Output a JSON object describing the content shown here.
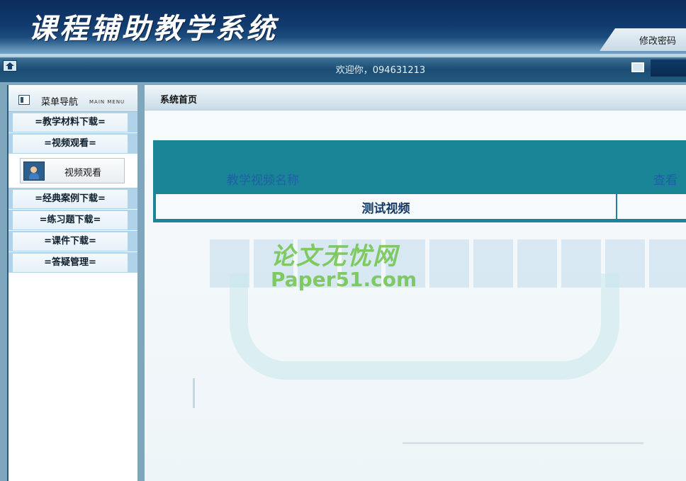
{
  "header": {
    "app_title": "课程辅助教学系统",
    "change_password": "修改密码"
  },
  "welcome_bar": {
    "text": "欢迎你，094631213"
  },
  "sidebar": {
    "title": "菜单导航",
    "subtitle": "MAIN MENU",
    "items": [
      {
        "label": "=教学材料下载="
      },
      {
        "label": "=视频观看="
      },
      {
        "label": "=经典案例下载="
      },
      {
        "label": "=练习题下载="
      },
      {
        "label": "=课件下载="
      },
      {
        "label": "=答疑管理="
      }
    ],
    "sub_item": {
      "label": "视频观看"
    }
  },
  "main": {
    "page_title": "系统首页",
    "table": {
      "columns": [
        "教学视频名称",
        "查看"
      ],
      "rows": [
        {
          "name": "测试视频",
          "view": ""
        }
      ]
    }
  },
  "watermark": {
    "line1": "论文无忧网",
    "line2": "Paper51.com"
  },
  "colors": {
    "header_dark": "#0c2c5c",
    "table_teal": "#198597",
    "menu_blue": "#b0d3ea"
  }
}
